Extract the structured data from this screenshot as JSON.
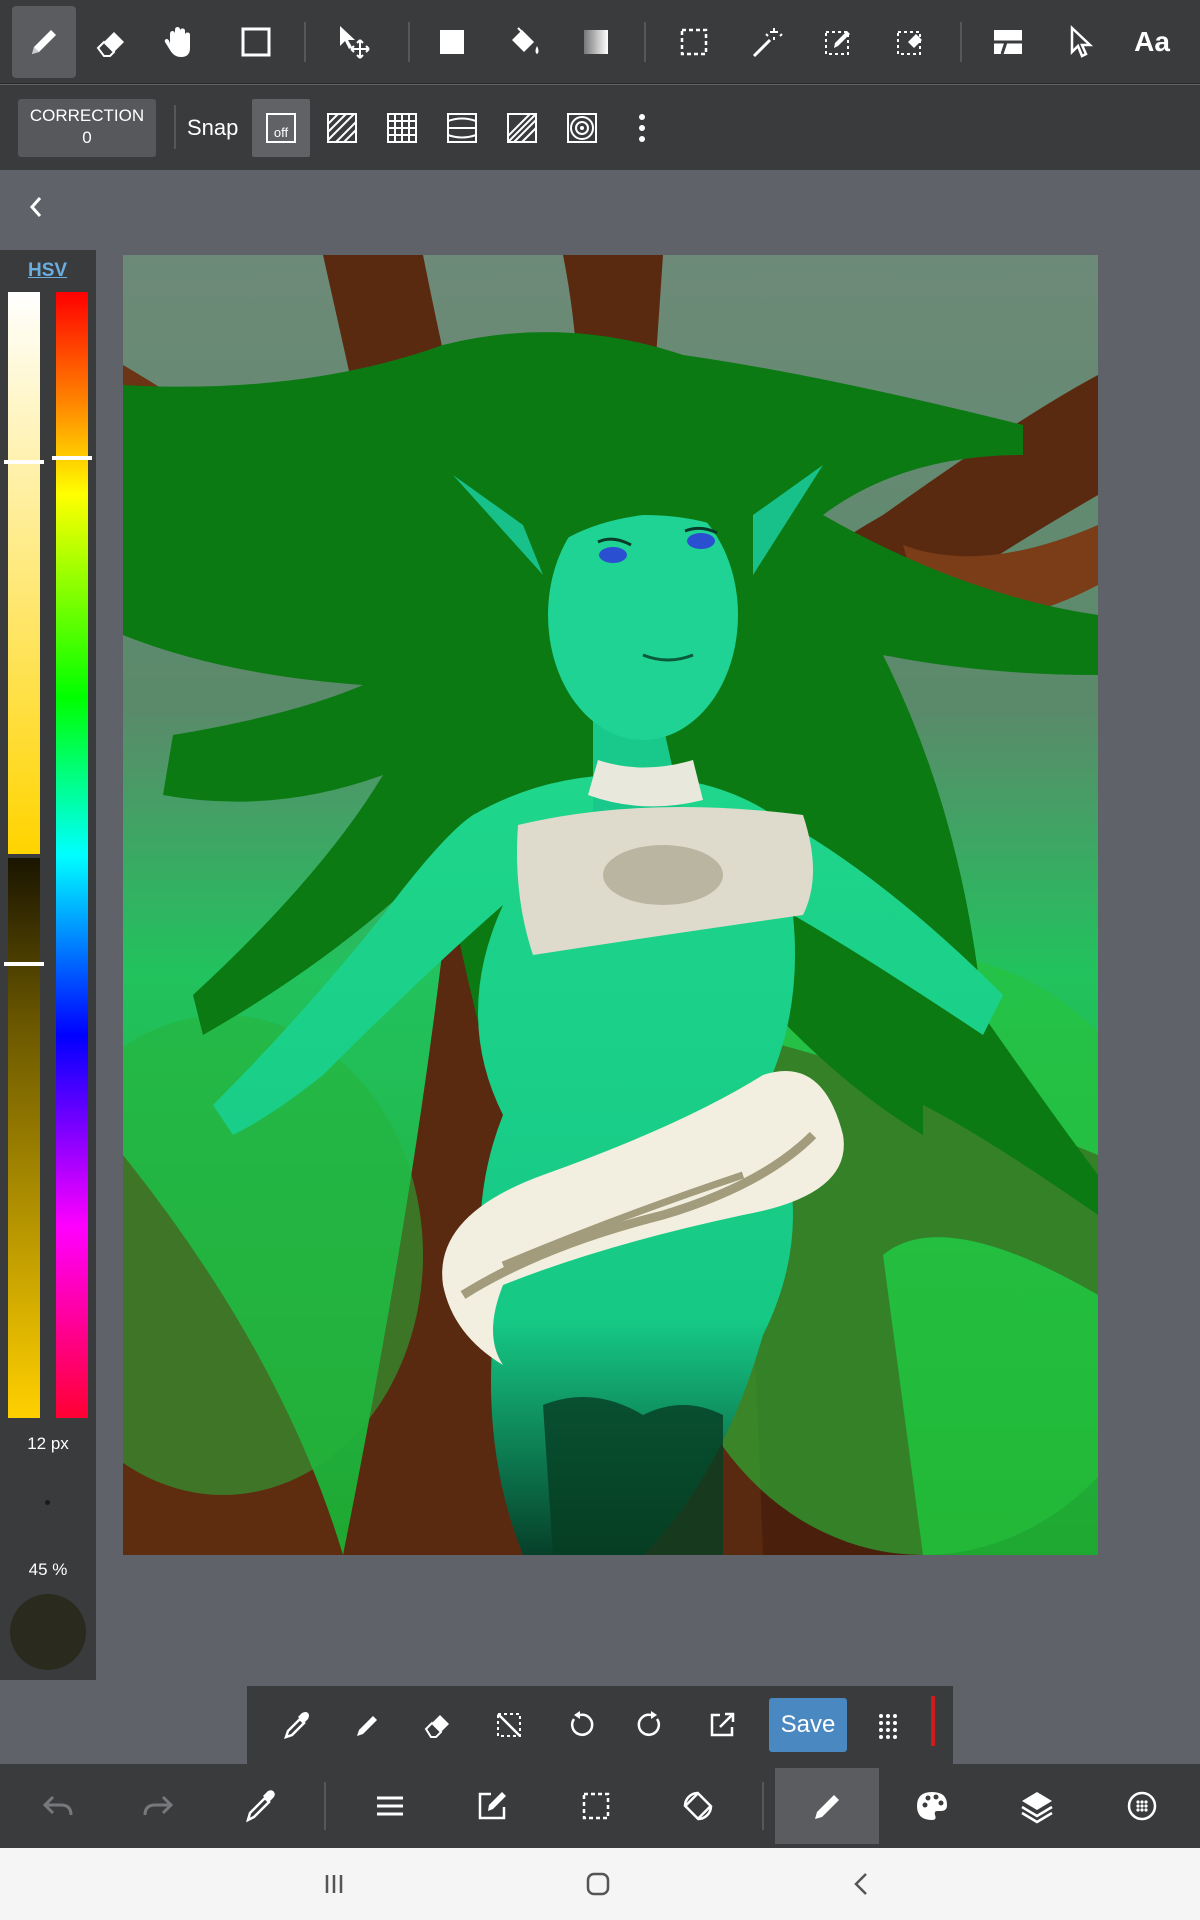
{
  "toolbar": {
    "tools": [
      "pen-icon",
      "eraser-icon",
      "hand-icon",
      "rectangle-icon",
      "move-icon",
      "fill-rect-icon",
      "bucket-icon",
      "gradient-icon",
      "select-icon",
      "magic-wand-icon",
      "select-pen-icon",
      "select-eraser-icon",
      "frame-icon",
      "pointer-icon",
      "text-icon"
    ],
    "text_tool_label": "Aa"
  },
  "subbar": {
    "correction_label": "CORRECTION",
    "correction_value": "0",
    "snap_label": "Snap",
    "snap_off_label": "off"
  },
  "colorpanel": {
    "mode_label": "HSV",
    "brush_size": "12 px",
    "opacity": "45 %",
    "current_color": "#2a2a1e"
  },
  "floatbar": {
    "save_label": "Save"
  },
  "colors": {
    "accent": "#4a88c2",
    "toolbar_bg": "#3a3b3d",
    "canvas_bg": "#5f6369"
  }
}
